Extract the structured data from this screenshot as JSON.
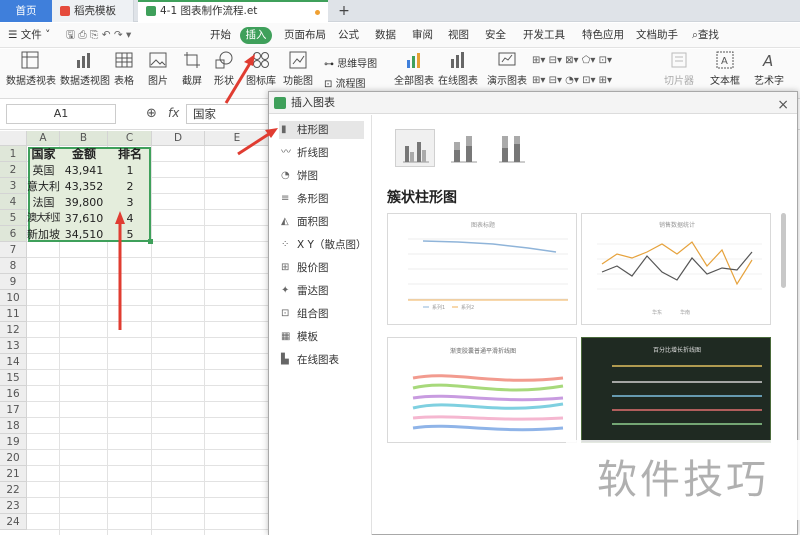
{
  "tabs": {
    "home": "首页",
    "template": "稻壳模板",
    "doc": "4-1 图表制作流程.et",
    "plus": "+"
  },
  "menu": {
    "file": "文件",
    "items": [
      "开始",
      "插入",
      "页面布局",
      "公式",
      "数据",
      "审阅",
      "视图",
      "安全",
      "开发工具",
      "特色应用",
      "文档助手"
    ],
    "search": "查找"
  },
  "ribbon": {
    "pivot_table": "数据透视表",
    "pivot_chart": "数据透视图",
    "table": "表格",
    "picture": "图片",
    "screenshot": "截屏",
    "shape": "形状",
    "icon_lib": "图标库",
    "func_chart": "功能图",
    "mindmap": "思维导图",
    "flowchart": "流程图",
    "all_charts": "全部图表",
    "online_chart": "在线图表",
    "demo_chart": "演示图表",
    "slicer": "切片器",
    "textbox": "文本框",
    "wordart": "艺术字"
  },
  "formula": {
    "namebox": "A1",
    "fx": "fx",
    "value": "国家"
  },
  "sheet": {
    "columns": [
      "A",
      "B",
      "C",
      "D",
      "E"
    ],
    "rows": [
      "1",
      "2",
      "3",
      "4",
      "5",
      "6",
      "7",
      "8",
      "9",
      "10",
      "11",
      "12",
      "13",
      "14",
      "15",
      "16",
      "17",
      "18",
      "19",
      "20",
      "21",
      "22",
      "23",
      "24"
    ],
    "headers": [
      "国家",
      "金额",
      "排名"
    ],
    "data": [
      [
        "英国",
        "43,941",
        "1"
      ],
      [
        "意大利",
        "43,352",
        "2"
      ],
      [
        "法国",
        "39,800",
        "3"
      ],
      [
        "澳大利亚",
        "37,610",
        "4"
      ],
      [
        "新加坡",
        "34,510",
        "5"
      ]
    ]
  },
  "dialog": {
    "title": "插入图表",
    "close": "×",
    "categories": [
      "柱形图",
      "折线图",
      "饼图",
      "条形图",
      "面积图",
      "X Y（散点图）",
      "股价图",
      "雷达图",
      "组合图",
      "模板",
      "在线图表"
    ],
    "selected_type": "簇状柱形图",
    "thumbs": [
      {
        "title": "图表标题",
        "legend": [
          "系列1",
          "系列2"
        ]
      },
      {
        "title": "销售数据统计",
        "legend": [
          "华东",
          "华南"
        ]
      },
      {
        "title": "渐变胶囊普通平滑折线图"
      },
      {
        "title": "百分比增长折线图"
      }
    ]
  },
  "colors": {
    "accent": "#3fa05b",
    "doc_tab_icon": "#3fa05b",
    "home_tab": "#3f7fdb",
    "arrow": "#e03c31"
  },
  "watermark": "软件技巧"
}
